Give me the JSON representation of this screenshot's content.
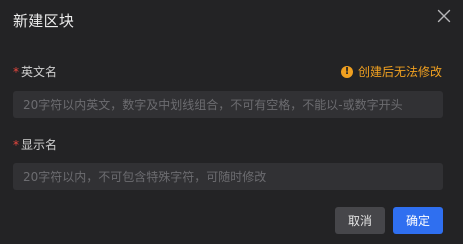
{
  "dialog": {
    "title": "新建区块",
    "close_icon": "close-icon"
  },
  "english_name": {
    "required_mark": "*",
    "label": "英文名",
    "warning_icon": "exclamation-icon",
    "warning_text": "创建后无法修改",
    "placeholder": "20字符以内英文，数字及中划线组合，不可有空格，不能以-或数字开头",
    "value": ""
  },
  "display_name": {
    "required_mark": "*",
    "label": "显示名",
    "placeholder": "20字符以内，不可包含特殊字符，可随时修改",
    "value": ""
  },
  "footer": {
    "cancel_label": "取消",
    "ok_label": "确定"
  },
  "colors": {
    "background": "#232325",
    "input_bg": "#313134",
    "warning": "#f0a020",
    "required": "#e8483f",
    "primary": "#2f6ff0"
  }
}
